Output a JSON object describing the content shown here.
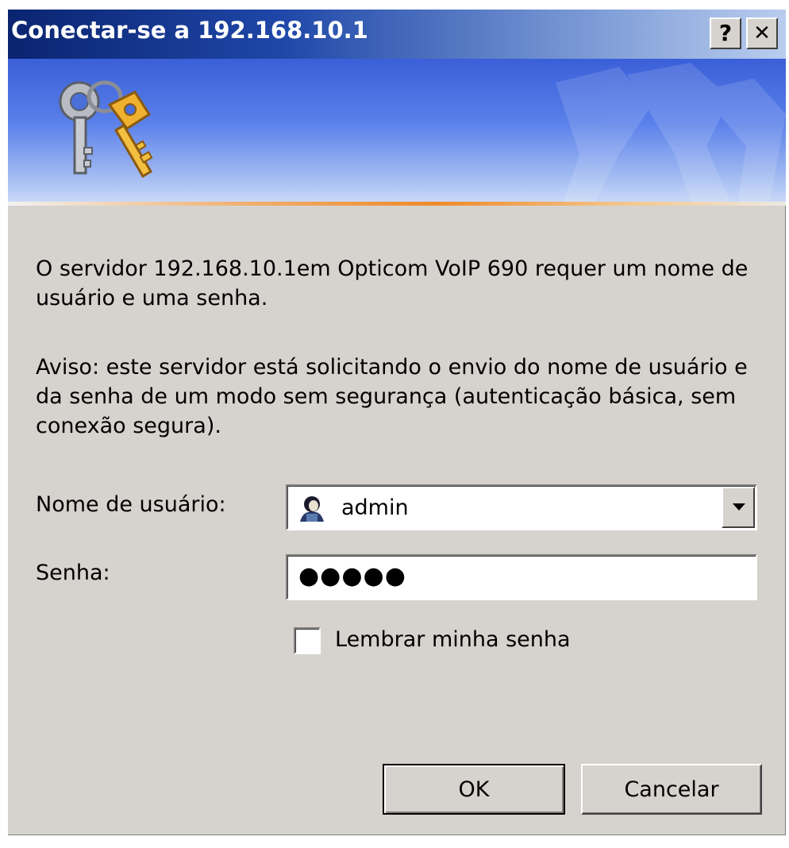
{
  "window": {
    "title": "Conectar-se a 192.168.10.1",
    "help_button": "?",
    "close_button": "✕"
  },
  "message": {
    "info": "O servidor 192.168.10.1em Opticom VoIP 690 requer um nome de usuário e uma senha.",
    "warning": "Aviso: este servidor está solicitando o envio do nome de usuário e da senha de um modo sem segurança (autenticação básica, sem conexão segura)."
  },
  "form": {
    "username_label": "Nome de usuário:",
    "username_value": "admin",
    "password_label": "Senha:",
    "password_value": "●●●●●",
    "remember_label": "Lembrar minha senha",
    "remember_checked": false
  },
  "buttons": {
    "ok": "OK",
    "cancel": "Cancelar"
  },
  "icons": {
    "banner": "keys-icon",
    "user": "user-icon",
    "dropdown": "chevron-down-icon"
  },
  "colors": {
    "titlebar_start": "#0a2470",
    "dialog_bg": "#d6d3ce",
    "banner_accent": "#ee8a2a"
  }
}
